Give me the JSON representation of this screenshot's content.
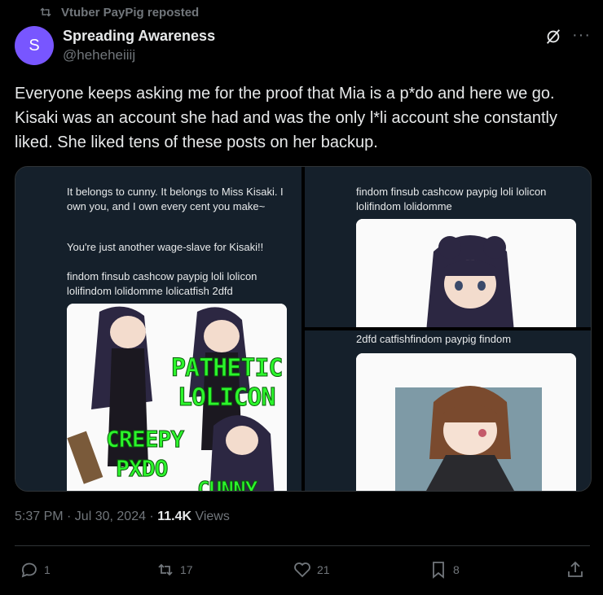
{
  "repost": {
    "label": "Vtuber PayPig reposted"
  },
  "author": {
    "avatar_letter": "S",
    "name": "Spreading Awareness",
    "handle": "@heheheiiij"
  },
  "tweet": {
    "text": "Everyone keeps asking me for the proof that Mia is a p*do and here we go. Kisaki was an account she had and was the only l*li account she constantly liked. She liked tens of these posts on her backup."
  },
  "media": {
    "panel1": {
      "text1": "It belongs to cunny. It belongs to Miss Kisaki. I own you, and I own every cent you make~",
      "text2": "You're just another wage-slave for Kisaki!!",
      "text3": "findom finsub cashcow paypig loli lolicon lolifindom lolidomme lolicatfish 2dfd",
      "meme": [
        "PATHETIC",
        "LOLICON",
        "CREEPY",
        "PXDO",
        "CUNNY"
      ]
    },
    "panel2": {
      "text": "findom finsub cashcow paypig loli lolicon lolifindom lolidomme"
    },
    "panel3": {
      "text": "2dfd catfishfindom paypig findom"
    }
  },
  "meta": {
    "time": "5:37 PM · Jul 30, 2024 · ",
    "views_count": "11.4K",
    "views_label": " Views"
  },
  "actions": {
    "replies": "1",
    "reposts": "17",
    "likes": "21",
    "bookmarks": "8"
  },
  "colors": {
    "accent": "#1d9bf0",
    "avatar": "#7856ff",
    "meme_green": "#2cf52c",
    "muted": "#71767b"
  }
}
